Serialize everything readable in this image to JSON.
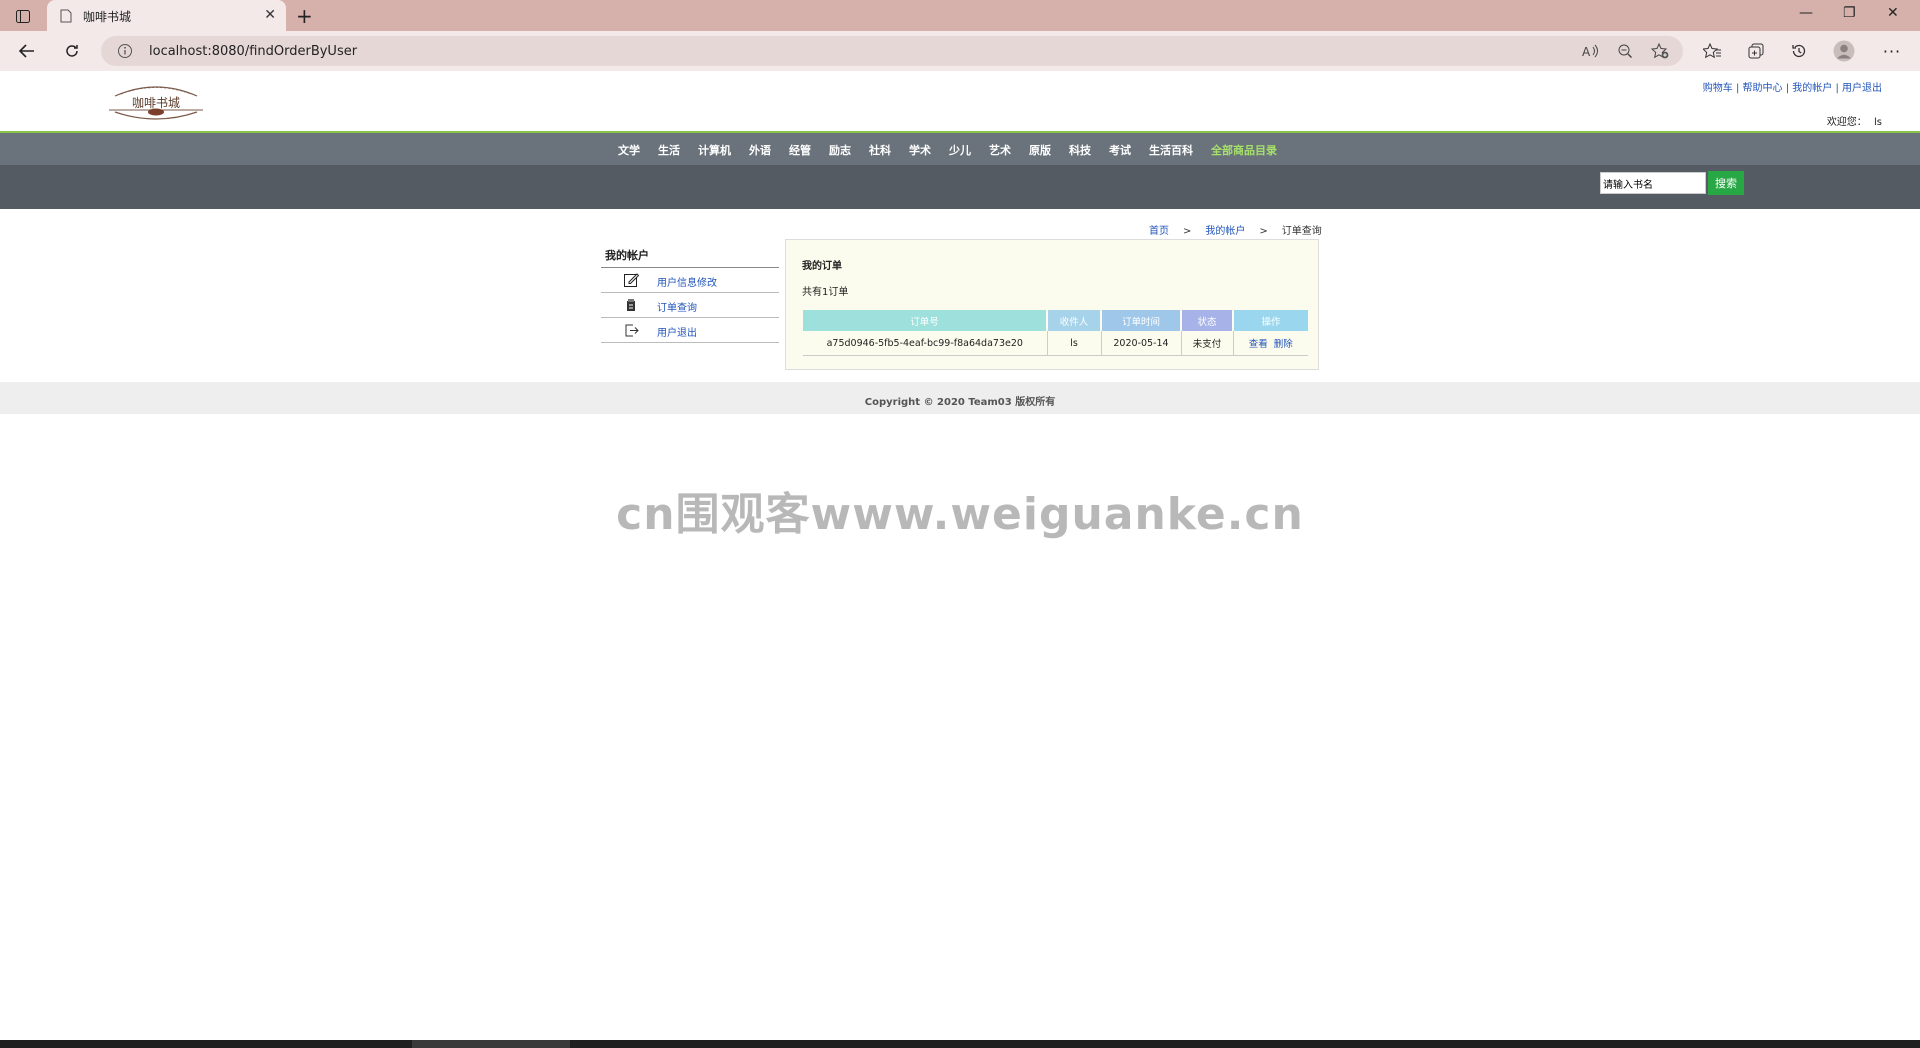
{
  "browser": {
    "tab_title": "咖啡书城",
    "url": "localhost:8080/findOrderByUser"
  },
  "header": {
    "logo_text": "咖啡书城",
    "top_links": [
      "购物车",
      "帮助中心",
      "我的帐户",
      "用户退出"
    ],
    "welcome_label": "欢迎您：",
    "username": "ls"
  },
  "nav": {
    "categories": [
      "文学",
      "生活",
      "计算机",
      "外语",
      "经管",
      "励志",
      "社科",
      "学术",
      "少儿",
      "艺术",
      "原版",
      "科技",
      "考试",
      "生活百科"
    ],
    "all_label": "全部商品目录"
  },
  "search": {
    "placeholder": "请输入书名",
    "button_label": "搜索"
  },
  "breadcrumb": {
    "home": "首页",
    "account": "我的帐户",
    "current": "订单查询",
    "separator": ">"
  },
  "sidebar": {
    "title": "我的帐户",
    "items": [
      {
        "label": "用户信息修改",
        "icon": "edit-icon"
      },
      {
        "label": "订单查询",
        "icon": "orders-icon"
      },
      {
        "label": "用户退出",
        "icon": "logout-icon"
      }
    ]
  },
  "orders": {
    "title": "我的订单",
    "count_text": "共有1订单",
    "columns": [
      "订单号",
      "收件人",
      "订单时间",
      "状态",
      "操作"
    ],
    "header_colors": [
      "#9ee0dc",
      "#a6d2ea",
      "#9ec7ea",
      "#a7b3e8",
      "#9ad7ee"
    ],
    "rows": [
      {
        "order_id": "a75d0946-5fb5-4eaf-bc99-f8a64da73e20",
        "receiver": "ls",
        "time": "2020-05-14",
        "status": "未支付",
        "actions": [
          "查看",
          "删除"
        ]
      }
    ]
  },
  "footer": {
    "copyright": "Copyright © 2020 Team03 版权所有"
  },
  "watermark": "cn围观客www.weiguanke.cn",
  "colors": {
    "tabbar": "#d6b1ac",
    "nav_bg": "#6a737c",
    "search_bg": "#545b62",
    "accent_green": "#8bc34a",
    "search_button": "#28a745"
  }
}
